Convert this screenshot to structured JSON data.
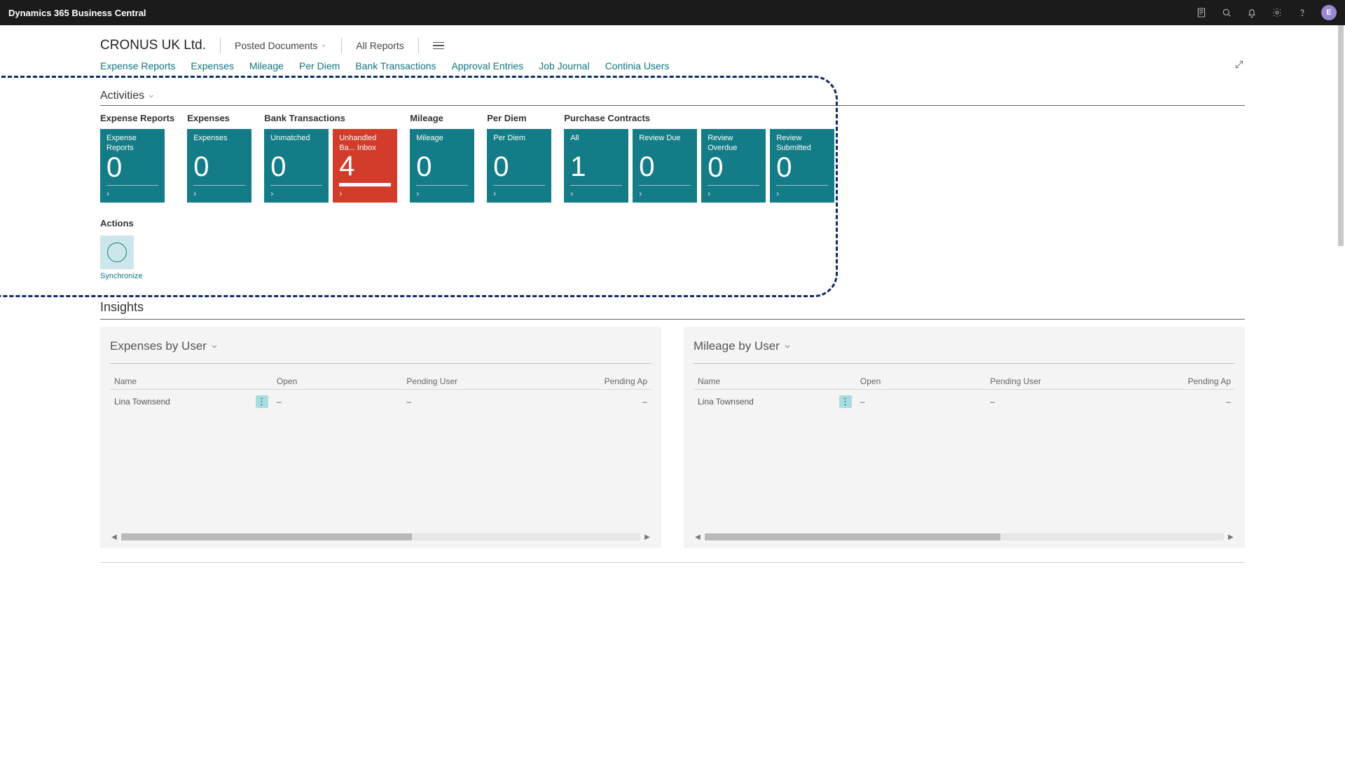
{
  "app_title": "Dynamics 365 Business Central",
  "avatar_initial": "E",
  "company": "CRONUS UK Ltd.",
  "header_menu": {
    "posted_docs": "Posted Documents",
    "all_reports": "All Reports"
  },
  "subnav": [
    "Expense Reports",
    "Expenses",
    "Mileage",
    "Per Diem",
    "Bank Transactions",
    "Approval Entries",
    "Job Journal",
    "Continia Users"
  ],
  "activities_label": "Activities",
  "tile_groups": [
    {
      "label": "Expense Reports",
      "tiles": [
        {
          "label": "Expense Reports",
          "value": "0",
          "danger": false
        }
      ]
    },
    {
      "label": "Expenses",
      "tiles": [
        {
          "label": "Expenses",
          "value": "0",
          "danger": false
        }
      ]
    },
    {
      "label": "Bank Transactions",
      "tiles": [
        {
          "label": "Unmatched",
          "value": "0",
          "danger": false
        },
        {
          "label": "Unhandled Ba... Inbox",
          "value": "4",
          "danger": true
        }
      ]
    },
    {
      "label": "Mileage",
      "tiles": [
        {
          "label": "Mileage",
          "value": "0",
          "danger": false
        }
      ]
    },
    {
      "label": "Per Diem",
      "tiles": [
        {
          "label": "Per Diem",
          "value": "0",
          "danger": false
        }
      ]
    },
    {
      "label": "Purchase Contracts",
      "tiles": [
        {
          "label": "All",
          "value": "1",
          "danger": false
        },
        {
          "label": "Review Due",
          "value": "0",
          "danger": false
        },
        {
          "label": "Review Overdue",
          "value": "0",
          "danger": false
        },
        {
          "label": "Review Submitted",
          "value": "0",
          "danger": false
        }
      ]
    }
  ],
  "actions_label": "Actions",
  "action_sync": "Synchronize",
  "insights_label": "Insights",
  "panels": {
    "expenses": {
      "title": "Expenses by User",
      "cols": [
        "Name",
        "Open",
        "Pending User",
        "Pending Ap"
      ],
      "rows": [
        {
          "name": "Lina Townsend",
          "open": "–",
          "pending_user": "–",
          "pending_ap": "–"
        }
      ],
      "thumb_width_pct": 56
    },
    "mileage": {
      "title": "Mileage by User",
      "cols": [
        "Name",
        "Open",
        "Pending User",
        "Pending Ap"
      ],
      "rows": [
        {
          "name": "Lina Townsend",
          "open": "–",
          "pending_user": "–",
          "pending_ap": "–"
        }
      ],
      "thumb_width_pct": 57
    }
  }
}
